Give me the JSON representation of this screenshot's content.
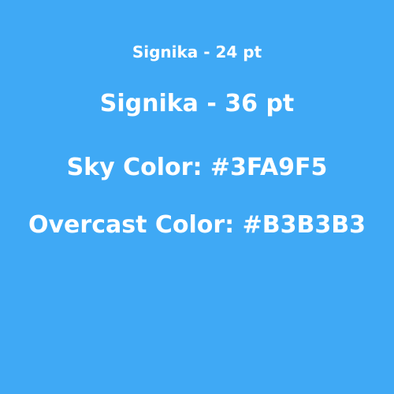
{
  "colors": {
    "background": "#3FA9F5",
    "text": "#FFFFFF"
  },
  "lines": [
    "Signika - 24 pt",
    "Signika - 36 pt",
    "Sky Color: #3FA9F5",
    "Overcast Color: #B3B3B3"
  ]
}
